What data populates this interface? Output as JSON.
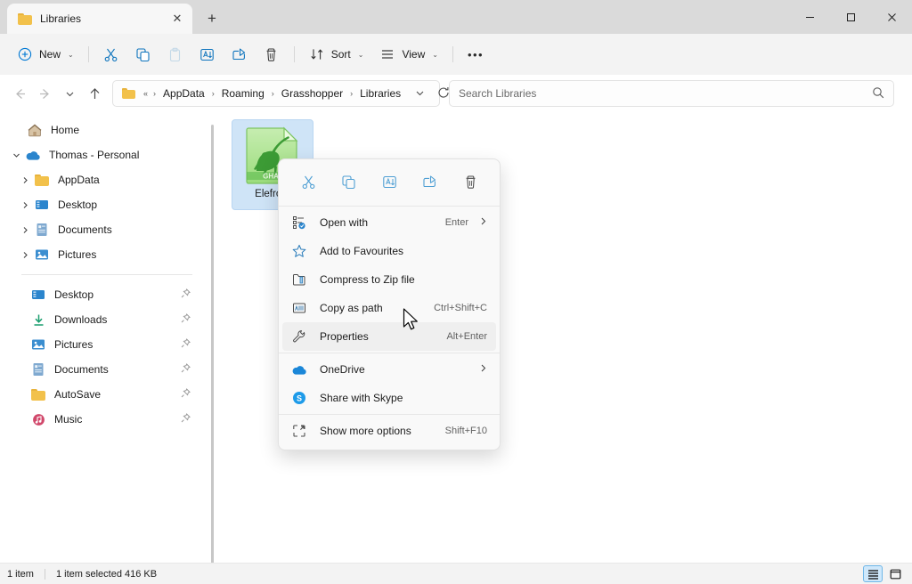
{
  "window": {
    "tab_title": "Libraries",
    "minimize_label": "–",
    "maximize_label": "□",
    "close_label": "✕",
    "newtab_label": "+",
    "tabclose_label": "✕"
  },
  "toolbar": {
    "new_label": "New",
    "cut_label": "Cut",
    "copy_label": "Copy",
    "paste_label": "Paste",
    "rename_label": "Rename",
    "share_label": "Share",
    "delete_label": "Delete",
    "sort_label": "Sort",
    "view_label": "View",
    "more_label": "•••",
    "chevron": "⌄"
  },
  "address": {
    "back_label": "←",
    "forward_label": "→",
    "recent_label": "⌄",
    "up_label": "↑",
    "prefix": "«",
    "crumbs": [
      "AppData",
      "Roaming",
      "Grasshopper",
      "Libraries"
    ],
    "separator": "›",
    "dropdown": "⌄",
    "refresh": "↻"
  },
  "search": {
    "placeholder": "Search Libraries",
    "icon": "search-icon"
  },
  "sidebar": {
    "items": [
      {
        "label": "Home",
        "icon": "home-icon",
        "expander": "",
        "pinned": false,
        "indent": 26
      },
      {
        "label": "Thomas - Personal",
        "icon": "onedrive-icon",
        "expander": "⌄",
        "pinned": false,
        "indent": 4
      },
      {
        "label": "AppData",
        "icon": "folder-icon",
        "expander": "›",
        "pinned": false,
        "indent": 14
      },
      {
        "label": "Desktop",
        "icon": "desktop-icon",
        "expander": "›",
        "pinned": false,
        "indent": 14
      },
      {
        "label": "Documents",
        "icon": "documents-icon",
        "expander": "›",
        "pinned": false,
        "indent": 14
      },
      {
        "label": "Pictures",
        "icon": "pictures-icon",
        "expander": "›",
        "pinned": false,
        "indent": 14
      }
    ],
    "quick_items": [
      {
        "label": "Desktop",
        "icon": "desktop-icon",
        "pin": "📌"
      },
      {
        "label": "Downloads",
        "icon": "downloads-icon",
        "pin": "📌"
      },
      {
        "label": "Pictures",
        "icon": "pictures-icon",
        "pin": "📌"
      },
      {
        "label": "Documents",
        "icon": "documents-icon",
        "pin": "📌"
      },
      {
        "label": "AutoSave",
        "icon": "folder-icon",
        "pin": "📌"
      },
      {
        "label": "Music",
        "icon": "music-icon",
        "pin": "📌"
      }
    ]
  },
  "content": {
    "file": {
      "name": "Elefront",
      "icon_label": "GHA",
      "selected": true
    }
  },
  "context_menu": {
    "top_icons": [
      {
        "name": "cut-icon",
        "label": "Cut"
      },
      {
        "name": "copy-icon",
        "label": "Copy"
      },
      {
        "name": "rename-icon",
        "label": "Rename"
      },
      {
        "name": "share-icon",
        "label": "Share"
      },
      {
        "name": "delete-icon",
        "label": "Delete"
      }
    ],
    "items": [
      {
        "label": "Open with",
        "accel": "Enter",
        "submenu": "›",
        "icon": "open-with-icon",
        "highlight": false
      },
      {
        "label": "Add to Favourites",
        "accel": "",
        "submenu": "",
        "icon": "star-icon",
        "highlight": false
      },
      {
        "label": "Compress to Zip file",
        "accel": "",
        "submenu": "",
        "icon": "zip-icon",
        "highlight": false
      },
      {
        "label": "Copy as path",
        "accel": "Ctrl+Shift+C",
        "submenu": "",
        "icon": "copy-path-icon",
        "highlight": false
      },
      {
        "label": "Properties",
        "accel": "Alt+Enter",
        "submenu": "",
        "icon": "wrench-icon",
        "highlight": true
      }
    ],
    "items2": [
      {
        "label": "OneDrive",
        "accel": "",
        "submenu": "›",
        "icon": "onedrive-icon",
        "highlight": false
      },
      {
        "label": "Share with Skype",
        "accel": "",
        "submenu": "",
        "icon": "skype-icon",
        "highlight": false
      }
    ],
    "items3": [
      {
        "label": "Show more options",
        "accel": "Shift+F10",
        "submenu": "",
        "icon": "more-options-icon",
        "highlight": false
      }
    ]
  },
  "status": {
    "item_count": "1 item",
    "selection": "1 item selected  416 KB",
    "view_details": "details-view",
    "view_icons": "large-icons-view"
  },
  "colors": {
    "accent": "#0078d4",
    "titlebar": "#dadada",
    "toolbar": "#f3f3f3",
    "selection": "#cfe4f7"
  }
}
